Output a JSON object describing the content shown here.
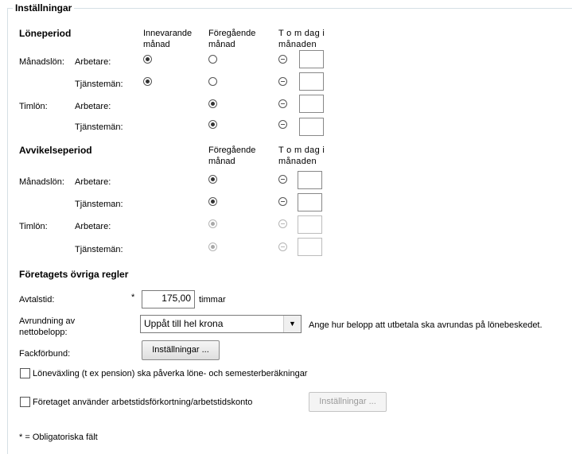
{
  "group_title": "Inställningar",
  "loneperiod": {
    "heading": "Löneperiod",
    "col_current": "Innevarande månad",
    "col_previous": "Föregående månad",
    "col_tom": "T o m dag i månaden",
    "manadslon_label": "Månadslön:",
    "timlon_label": "Timlön:",
    "arbetare": "Arbetare:",
    "tjansteman": "Tjänstemän:"
  },
  "avvikelseperiod": {
    "heading": "Avvikelseperiod",
    "col_previous": "Föregående månad",
    "col_tom": "T o m dag i månaden",
    "manadslon_label": "Månadslön:",
    "timlon_label": "Timlön:",
    "arbetare": "Arbetare:",
    "tjansteman_m": "Tjänsteman:",
    "tjansteman_t": "Tjänstemän:"
  },
  "ovriga": {
    "heading": "Företagets övriga regler",
    "avtalstid_label": "Avtalstid:",
    "required_mark": "*",
    "avtalstid_value": "175,00",
    "avtalstid_unit": "timmar",
    "avrundning_label": "Avrundning av nettobelopp:",
    "avrundning_value": "Uppåt till hel krona",
    "avrundning_hint": "Ange hur belopp att utbetala ska avrundas på lönebeskedet.",
    "fackforbund_label": "Fackförbund:",
    "installningar_button": "Inställningar ...",
    "lonevaxling_label": "Löneväxling (t ex pension) ska påverka löne- och semesterberäkningar",
    "arbetstid_label": "Företaget använder arbetstidsförkortning/arbetstidskonto",
    "installningar_button2": "Inställningar ...",
    "footnote": "* = Obligatoriska fält"
  }
}
